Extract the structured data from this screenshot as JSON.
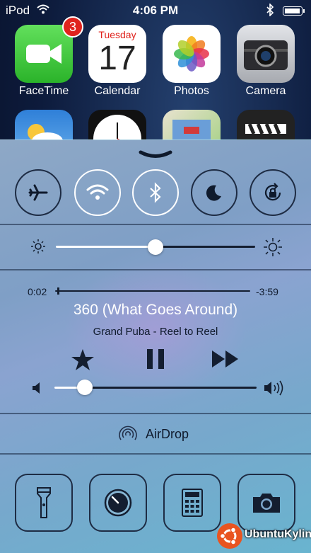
{
  "status_bar": {
    "carrier": "iPod",
    "time": "4:06 PM"
  },
  "home_apps": [
    {
      "label": "FaceTime",
      "badge": "3"
    },
    {
      "label": "Calendar",
      "weekday": "Tuesday",
      "day": "17"
    },
    {
      "label": "Photos"
    },
    {
      "label": "Camera"
    }
  ],
  "toggles": [
    {
      "name": "airplane-mode",
      "icon": "airplane-icon",
      "on": false
    },
    {
      "name": "wifi",
      "icon": "wifi-icon",
      "on": true
    },
    {
      "name": "bluetooth",
      "icon": "bluetooth-icon",
      "on": true
    },
    {
      "name": "do-not-disturb",
      "icon": "moon-icon",
      "on": false
    },
    {
      "name": "rotation-lock",
      "icon": "rotation-lock-icon",
      "on": false
    }
  ],
  "brightness": {
    "level": 0.5
  },
  "now_playing": {
    "elapsed": "0:02",
    "remaining": "-3:59",
    "progress": 0.01,
    "title": "360 (What Goes Around)",
    "subtitle": "Grand Puba - Reel to Reel"
  },
  "volume": {
    "level": 0.15
  },
  "airdrop": {
    "label": "AirDrop"
  },
  "shortcuts": [
    {
      "name": "flashlight",
      "icon": "flashlight-icon"
    },
    {
      "name": "timer",
      "icon": "timer-icon"
    },
    {
      "name": "calculator",
      "icon": "calculator-icon"
    },
    {
      "name": "camera",
      "icon": "camera-icon"
    }
  ],
  "watermark": {
    "text": "UbuntuKylin"
  },
  "colors": {
    "accent_red": "#e0231d",
    "track_dark": "#141e30",
    "track_light": "#ffffff"
  }
}
